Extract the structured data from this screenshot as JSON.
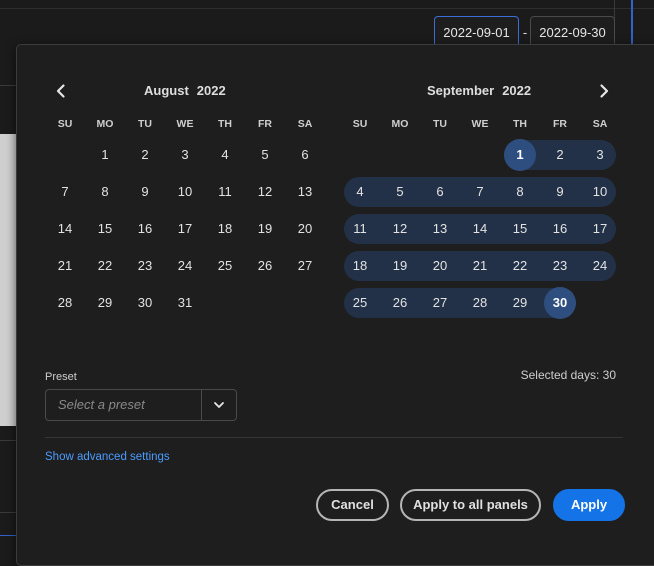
{
  "date_range": {
    "start": "2022-09-01",
    "separator": "-",
    "end": "2022-09-30"
  },
  "calendars": [
    {
      "month": "August",
      "year": "2022",
      "weekdays": [
        "SU",
        "MO",
        "TU",
        "WE",
        "TH",
        "FR",
        "SA"
      ],
      "weeks": [
        [
          "",
          "1",
          "2",
          "3",
          "4",
          "5",
          "6"
        ],
        [
          "7",
          "8",
          "9",
          "10",
          "11",
          "12",
          "13"
        ],
        [
          "14",
          "15",
          "16",
          "17",
          "18",
          "19",
          "20"
        ],
        [
          "21",
          "22",
          "23",
          "24",
          "25",
          "26",
          "27"
        ],
        [
          "28",
          "29",
          "30",
          "31",
          "",
          "",
          ""
        ]
      ]
    },
    {
      "month": "September",
      "year": "2022",
      "weekdays": [
        "SU",
        "MO",
        "TU",
        "WE",
        "TH",
        "FR",
        "SA"
      ],
      "weeks": [
        [
          "",
          "",
          "",
          "",
          "1",
          "2",
          "3"
        ],
        [
          "4",
          "5",
          "6",
          "7",
          "8",
          "9",
          "10"
        ],
        [
          "11",
          "12",
          "13",
          "14",
          "15",
          "16",
          "17"
        ],
        [
          "18",
          "19",
          "20",
          "21",
          "22",
          "23",
          "24"
        ],
        [
          "25",
          "26",
          "27",
          "28",
          "29",
          "30",
          ""
        ]
      ]
    }
  ],
  "selection": {
    "month_index": 1,
    "start_day": "1",
    "end_day": "30",
    "range_color": "#223148",
    "endpoint_color": "#2e4e80"
  },
  "preset": {
    "label": "Preset",
    "placeholder": "Select a preset"
  },
  "selected_days_text": "Selected days: 30",
  "advanced_link": "Show advanced settings",
  "buttons": {
    "cancel": "Cancel",
    "apply_all": "Apply to all panels",
    "apply": "Apply"
  },
  "colors": {
    "accent": "#1473e6",
    "link": "#4b9cff"
  }
}
